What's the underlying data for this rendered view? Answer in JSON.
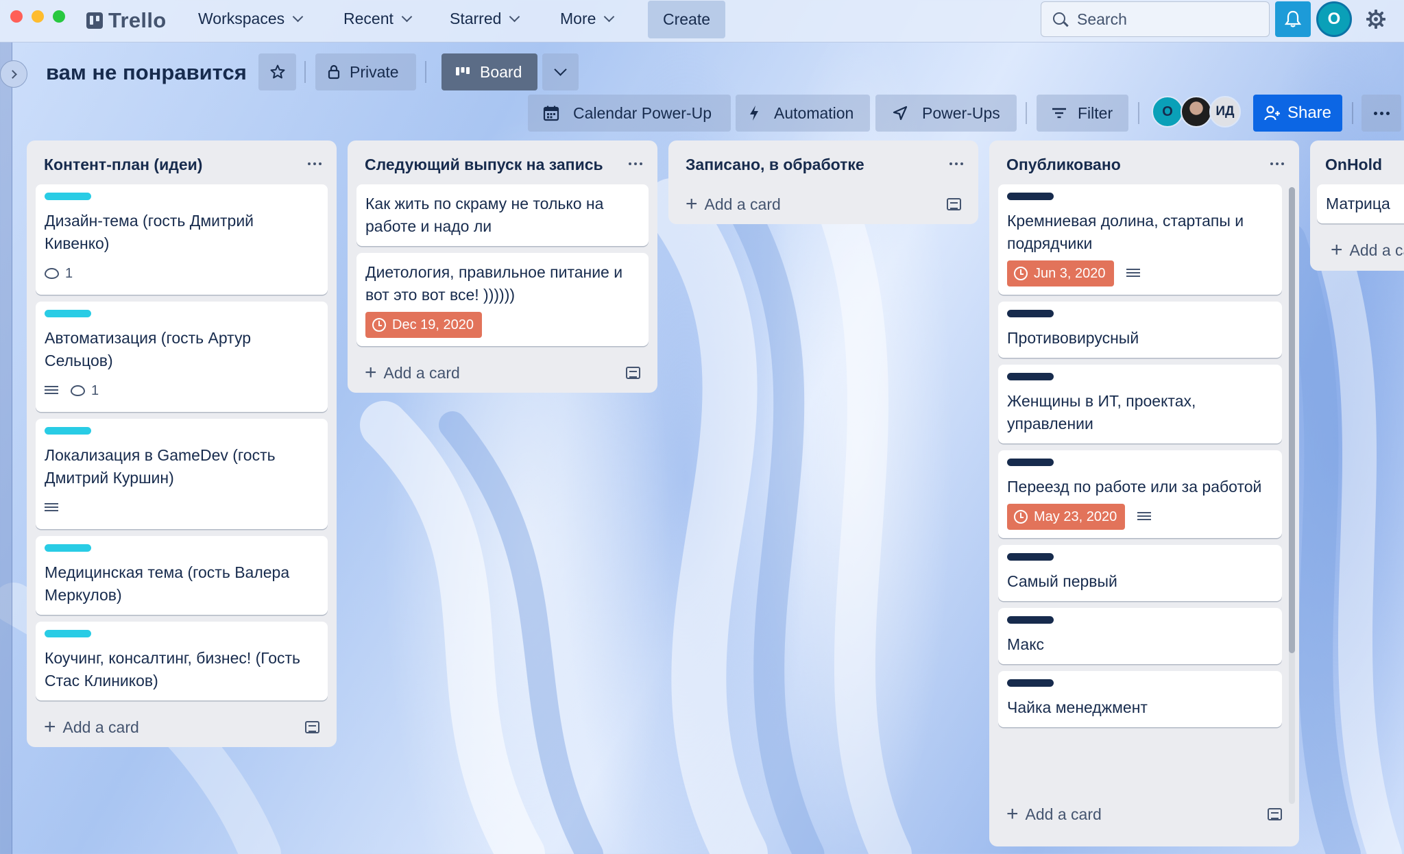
{
  "window": {
    "traffic_lights": [
      "close",
      "minimize",
      "maximize"
    ]
  },
  "topbar": {
    "logo": "Trello",
    "nav": [
      "Workspaces",
      "Recent",
      "Starred",
      "More"
    ],
    "create": "Create",
    "search_placeholder": "Search",
    "avatar_initial": "O"
  },
  "board": {
    "title": "вам не понравится",
    "visibility": "Private",
    "view": "Board",
    "powerups": [
      "Calendar Power-Up",
      "Automation",
      "Power-Ups"
    ],
    "filter": "Filter",
    "members": [
      {
        "initials": "O",
        "color": "#0aa0b8"
      },
      {
        "initials": "",
        "color": "#2a2a2a"
      },
      {
        "initials": "ИД",
        "color": "#dfe1e6"
      }
    ],
    "share": "Share"
  },
  "add_card_label": "Add a card",
  "colors": {
    "label_cyan": "#29cce5",
    "label_navy": "#172b4d",
    "due_overdue": "#e2735a",
    "share_blue": "#0c66e4"
  },
  "lists": [
    {
      "title": "Контент-план (идеи)",
      "cards": [
        {
          "label": "#29cce5",
          "text": "Дизайн-тема (гость Дмитрий Кивенко)",
          "comments": "1",
          "description": false
        },
        {
          "label": "#29cce5",
          "text": "Автоматизация (гость Артур Сельцов)",
          "comments": "1",
          "description": true
        },
        {
          "label": "#29cce5",
          "text": "Локализация в GameDev (гость Дмитрий Куршин)",
          "description": true
        },
        {
          "label": "#29cce5",
          "text": "Медицинская тема (гость Валера Меркулов)"
        },
        {
          "label": "#29cce5",
          "text": "Коучинг, консалтинг, бизнес! (Гость Стас Клиников)"
        }
      ]
    },
    {
      "title": "Следующий выпуск на запись",
      "cards": [
        {
          "text": "Как жить по скраму не только на работе и надо ли"
        },
        {
          "text": "Диетология, правильное питание и вот это вот все! ))))))",
          "due": "Dec 19, 2020"
        }
      ]
    },
    {
      "title": "Записано, в обработке",
      "cards": []
    },
    {
      "title": "Опубликовано",
      "cards": [
        {
          "label": "#172b4d",
          "text": "Кремниевая долина, стартапы и подрядчики",
          "due": "Jun 3, 2020",
          "description": true
        },
        {
          "label": "#172b4d",
          "text": "Противовирусный"
        },
        {
          "label": "#172b4d",
          "text": "Женщины в ИТ, проектах, управлении"
        },
        {
          "label": "#172b4d",
          "text": "Переезд по работе или за работой",
          "due": "May 23, 2020",
          "description": true
        },
        {
          "label": "#172b4d",
          "text": "Самый первый"
        },
        {
          "label": "#172b4d",
          "text": "Макс"
        },
        {
          "label": "#172b4d",
          "text": "Чайка менеджмент"
        }
      ]
    },
    {
      "title": "OnHold",
      "cards": [
        {
          "text": "Матрица"
        }
      ]
    }
  ]
}
